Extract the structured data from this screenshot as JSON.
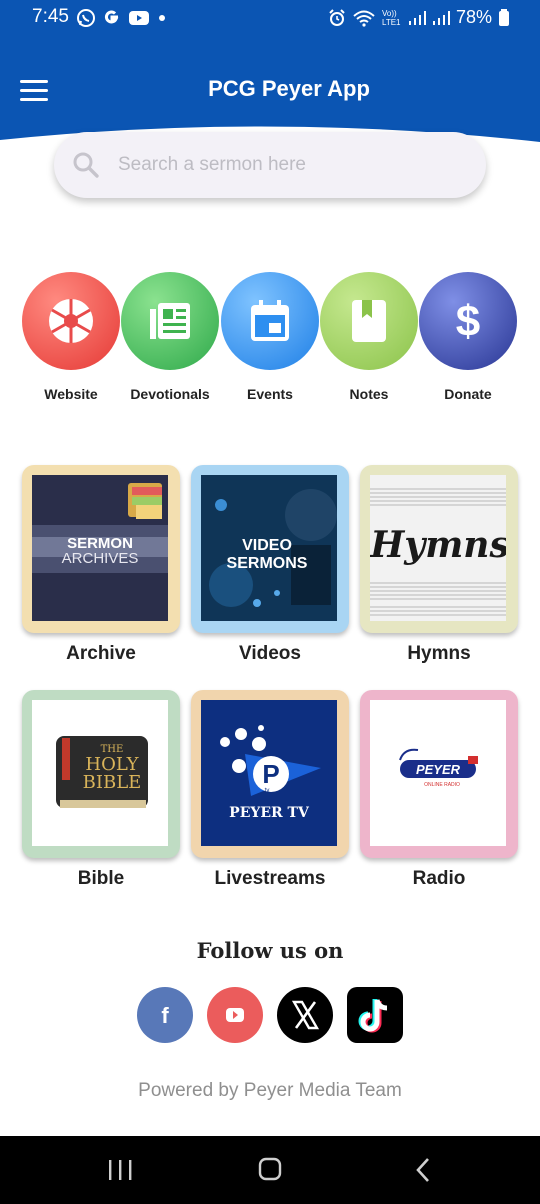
{
  "status_bar": {
    "time": "7:45",
    "left_icons": [
      "whatsapp-icon",
      "google-icon",
      "youtube-icon",
      "dot"
    ],
    "right_icons": [
      "alarm-icon",
      "wifi-icon",
      "volte-icon",
      "signal-icon",
      "signal-icon-2"
    ],
    "volte_text": "Vo)) LTE1",
    "battery": "78%"
  },
  "header": {
    "title": "PCG Peyer App",
    "menu_icon": "hamburger-icon",
    "brand_color": "#0b55b3"
  },
  "search": {
    "placeholder": "Search a sermon here",
    "icon": "search-icon"
  },
  "quick_actions": [
    {
      "label": "Website",
      "icon": "aperture-icon",
      "color": "#e84b4b"
    },
    {
      "label": "Devotionals",
      "icon": "newspaper-icon",
      "color": "#3fb34f"
    },
    {
      "label": "Events",
      "icon": "calendar-icon",
      "color": "#2e8ff0"
    },
    {
      "label": "Notes",
      "icon": "book-icon",
      "color": "#8bc34a"
    },
    {
      "label": "Donate",
      "icon": "dollar-icon",
      "color": "#3949ab"
    }
  ],
  "tiles": [
    {
      "label": "Archive",
      "frame_color": "#f3dfb0",
      "image_text": [
        "SERMON",
        "ARCHIVES"
      ]
    },
    {
      "label": "Videos",
      "frame_color": "#a9d5f3",
      "image_text": [
        "VIDEO",
        "SERMONS"
      ]
    },
    {
      "label": "Hymns",
      "frame_color": "#e6e6c2",
      "image_text": [
        "Hymns"
      ]
    },
    {
      "label": "Bible",
      "frame_color": "#bfdcc3",
      "image_text": [
        "THE",
        "HOLY",
        "BIBLE"
      ]
    },
    {
      "label": "Livestreams",
      "frame_color": "#f1d5ad",
      "image_text": [
        "P",
        "tv",
        "PEYER TV"
      ]
    },
    {
      "label": "Radio",
      "frame_color": "#eeb5cb",
      "image_text": [
        "PEYER",
        "ONLINE RADIO"
      ]
    }
  ],
  "follow": {
    "title": "Follow us on",
    "networks": [
      "facebook-icon",
      "youtube-icon",
      "x-icon",
      "tiktok-icon"
    ]
  },
  "footer": {
    "powered_by": "Powered by Peyer Media Team"
  },
  "navigation_bar": [
    "recents-button",
    "home-button",
    "back-button"
  ]
}
